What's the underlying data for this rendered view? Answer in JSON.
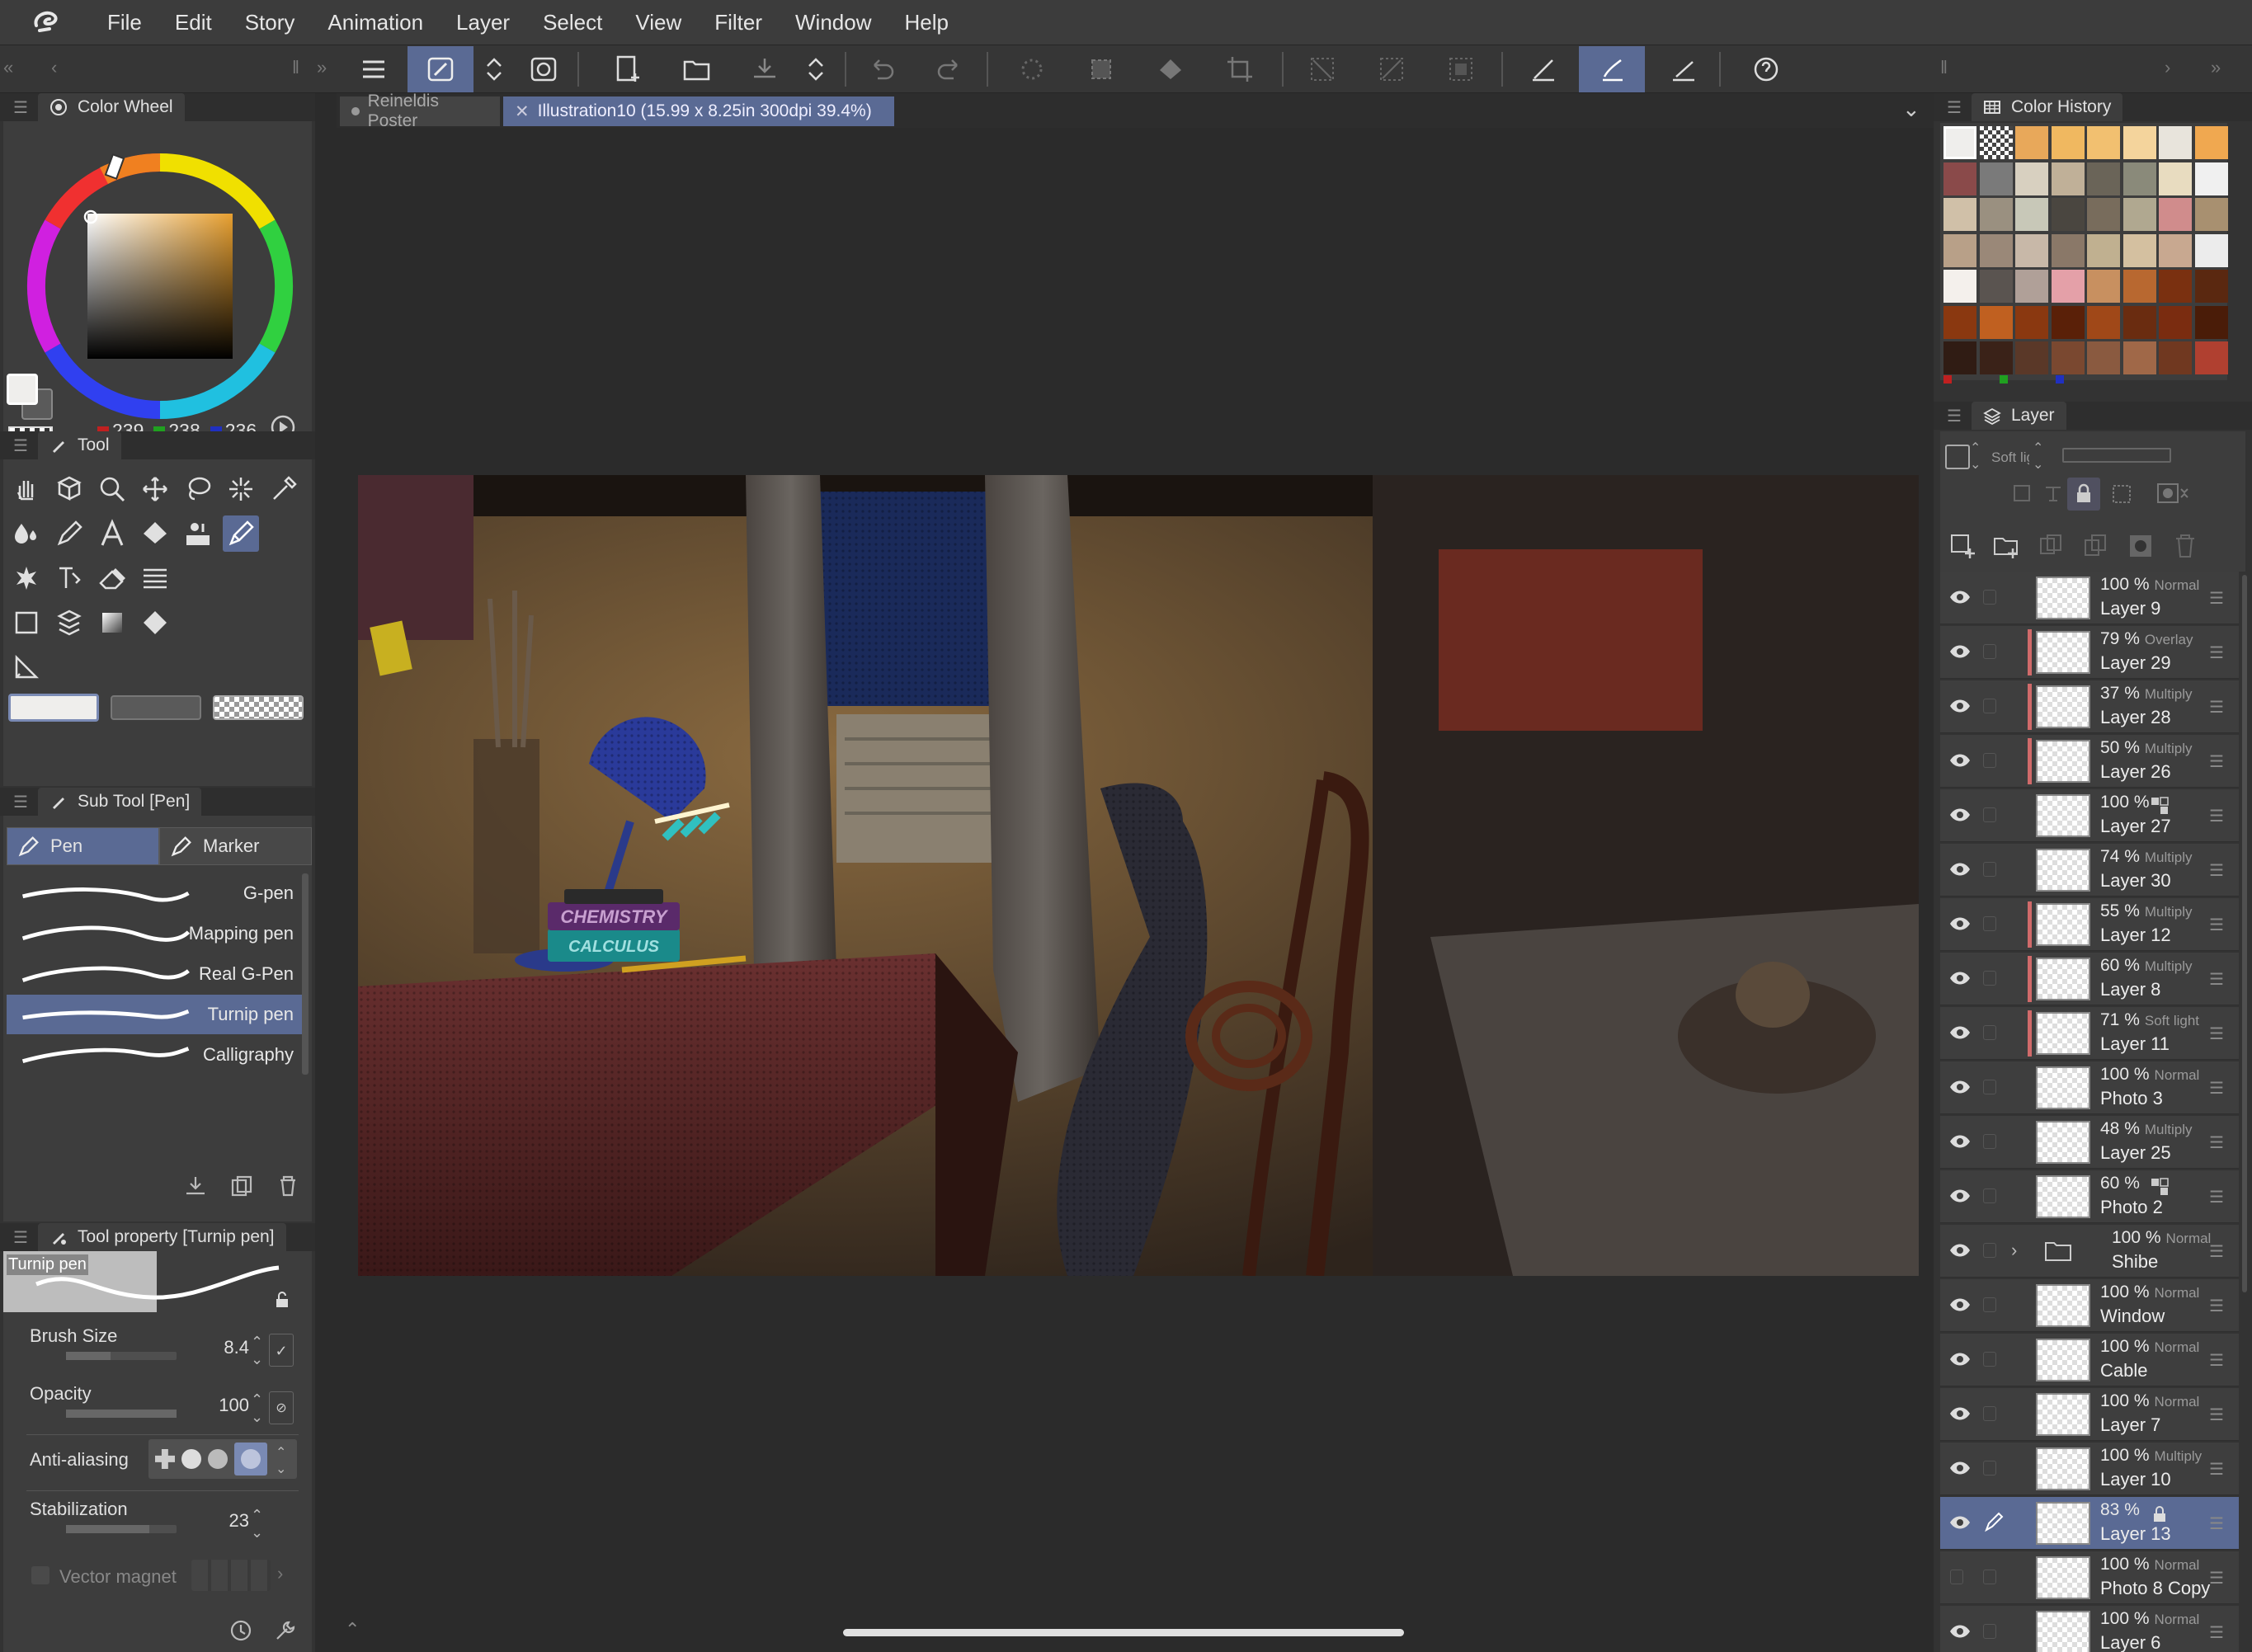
{
  "menubar": {
    "items": [
      "File",
      "Edit",
      "Story",
      "Animation",
      "Layer",
      "Select",
      "View",
      "Filter",
      "Window",
      "Help"
    ]
  },
  "document_tabs": [
    {
      "label": "Reineldis Poster",
      "active": false
    },
    {
      "label": "Illustration10 (15.99 x 8.25in 300dpi 39.4%)",
      "active": true
    }
  ],
  "color_wheel": {
    "title": "Color Wheel",
    "r": "239",
    "g": "238",
    "b": "236",
    "main_color": "#efeeec",
    "sub_color": "#5a5a5a"
  },
  "tool_panel": {
    "title": "Tool"
  },
  "sub_tool": {
    "title": "Sub Tool [Pen]",
    "tabs": [
      {
        "label": "Pen",
        "active": true
      },
      {
        "label": "Marker",
        "active": false
      }
    ],
    "brushes": [
      {
        "label": "G-pen",
        "active": false
      },
      {
        "label": "Mapping pen",
        "active": false
      },
      {
        "label": "Real G-Pen",
        "active": false
      },
      {
        "label": "Turnip pen",
        "active": true
      },
      {
        "label": "Calligraphy",
        "active": false
      }
    ]
  },
  "tool_property": {
    "title": "Tool property [Turnip pen]",
    "preview_label": "Turnip pen",
    "brush_size_label": "Brush Size",
    "brush_size": "8.4",
    "opacity_label": "Opacity",
    "opacity": "100",
    "antialias_label": "Anti-aliasing",
    "stabilization_label": "Stabilization",
    "stabilization": "23",
    "vector_magnet_label": "Vector magnet"
  },
  "color_history": {
    "title": "Color History",
    "swatches": [
      "#efeeec",
      "checker",
      "#e8a85a",
      "#f0b860",
      "#f2c070",
      "#f4d49c",
      "#e8e4dc",
      "#f0a850",
      "#8a4a4a",
      "#7a7a7a",
      "#d8d0c0",
      "#c0b098",
      "#6a6458",
      "#8a8a7a",
      "#e8dcc0",
      "#f0f0f0",
      "#d0c0a8",
      "#9a9080",
      "#c8c8b8",
      "#4a4640",
      "#786c5c",
      "#b0a890",
      "#d08c8c",
      "#a89070",
      "#b8a088",
      "#9a8878",
      "#c8b8a8",
      "#8a7868",
      "#c0b090",
      "#d4c0a0",
      "#c8a890",
      "#ececec",
      "#f4f0ec",
      "#5a5450",
      "#b0a098",
      "#e4a0a8",
      "#c89060",
      "#b86830",
      "#7a3010",
      "#5a2810",
      "#8a3810",
      "#c06020",
      "#8a3810",
      "#5a2008",
      "#a04818",
      "#6a2c10",
      "#7a2c10",
      "#4a1c08",
      "#301c14",
      "#3a2218",
      "#5a3828",
      "#7a4830",
      "#8a5a40",
      "#a06848",
      "#703820",
      "#b04030"
    ]
  },
  "layer_panel": {
    "title": "Layer",
    "blend_mode": "Soft light",
    "layers": [
      {
        "pct": "100 %",
        "mode": "Normal",
        "name": "Layer 9",
        "clip": false,
        "sel": false,
        "visible": true
      },
      {
        "pct": "79 %",
        "mode": "Overlay",
        "name": "Layer 29",
        "clip": true,
        "sel": false,
        "visible": true
      },
      {
        "pct": "37 %",
        "mode": "Multiply",
        "name": "Layer 28",
        "clip": true,
        "sel": false,
        "visible": true
      },
      {
        "pct": "50 %",
        "mode": "Multiply",
        "name": "Layer 26",
        "clip": true,
        "sel": false,
        "visible": true
      },
      {
        "pct": "100 %",
        "mode": "",
        "name": "Layer 27",
        "clip": false,
        "sel": false,
        "visible": true,
        "icon": "sub"
      },
      {
        "pct": "74 %",
        "mode": "Multiply",
        "name": "Layer 30",
        "clip": false,
        "sel": false,
        "visible": true
      },
      {
        "pct": "55 %",
        "mode": "Multiply",
        "name": "Layer 12",
        "clip": true,
        "sel": false,
        "visible": true
      },
      {
        "pct": "60 %",
        "mode": "Multiply",
        "name": "Layer 8",
        "clip": true,
        "sel": false,
        "visible": true
      },
      {
        "pct": "71 %",
        "mode": "Soft light",
        "name": "Layer 11",
        "clip": true,
        "sel": false,
        "visible": true
      },
      {
        "pct": "100 %",
        "mode": "Normal",
        "name": "Photo 3",
        "clip": false,
        "sel": false,
        "visible": true
      },
      {
        "pct": "48 %",
        "mode": "Multiply",
        "name": "Layer 25",
        "clip": false,
        "sel": false,
        "visible": true
      },
      {
        "pct": "60 %",
        "mode": "",
        "name": "Photo 2",
        "clip": false,
        "sel": false,
        "visible": true,
        "icon": "sub"
      },
      {
        "pct": "100 %",
        "mode": "Normal",
        "name": "Shibe",
        "clip": false,
        "sel": false,
        "visible": true,
        "folder": true
      },
      {
        "pct": "100 %",
        "mode": "Normal",
        "name": "Window",
        "clip": false,
        "sel": false,
        "visible": true
      },
      {
        "pct": "100 %",
        "mode": "Normal",
        "name": "Cable",
        "clip": false,
        "sel": false,
        "visible": true
      },
      {
        "pct": "100 %",
        "mode": "Normal",
        "name": "Layer 7",
        "clip": false,
        "sel": false,
        "visible": true
      },
      {
        "pct": "100 %",
        "mode": "Multiply",
        "name": "Layer 10",
        "clip": false,
        "sel": false,
        "visible": true
      },
      {
        "pct": "83 %",
        "mode": "",
        "name": "Layer 13",
        "clip": false,
        "sel": true,
        "visible": true,
        "icon": "lock"
      },
      {
        "pct": "100 %",
        "mode": "Normal",
        "name": "Photo 8 Copy",
        "clip": false,
        "sel": false,
        "visible": false
      },
      {
        "pct": "100 %",
        "mode": "Normal",
        "name": "Layer 6",
        "clip": false,
        "sel": false,
        "visible": true
      }
    ]
  },
  "artwork": {
    "book_top": "CHEMISTRY",
    "book_bottom": "CALCULUS"
  },
  "colors": {
    "accent": "#5a6a94",
    "panel": "#3d3d3d",
    "menubar": "#3c3c3c"
  }
}
